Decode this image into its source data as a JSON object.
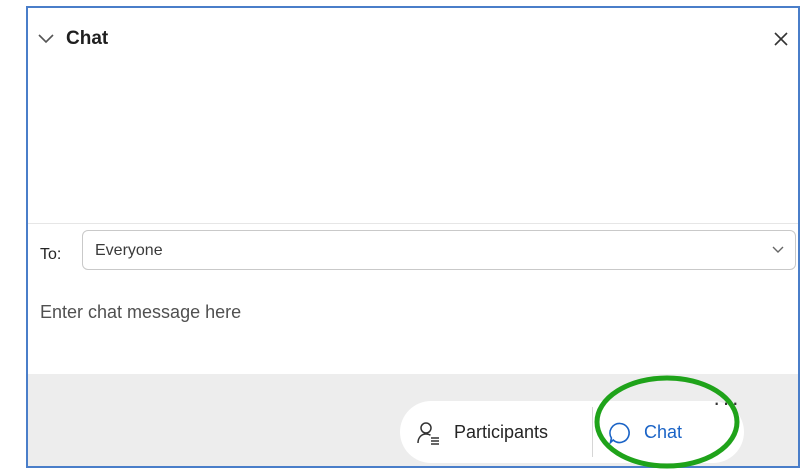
{
  "panel": {
    "title": "Chat",
    "icons": {
      "collapse": "chevron-down-icon",
      "close": "close-icon"
    }
  },
  "recipient": {
    "label": "To:",
    "selected": "Everyone",
    "icon": "chevron-down-icon"
  },
  "composer": {
    "placeholder": "Enter chat message here",
    "value": ""
  },
  "toolbar": {
    "participants_label": "Participants",
    "participants_icon": "participants-icon",
    "chat_label": "Chat",
    "chat_icon": "chat-bubble-icon",
    "more_label": "···",
    "more_icon": "more-options-icon"
  },
  "colors": {
    "accent": "#1a63c6",
    "panel_border": "#4a7ec9",
    "footer_bg": "#ededed",
    "highlight_ring": "#1fa31a"
  }
}
